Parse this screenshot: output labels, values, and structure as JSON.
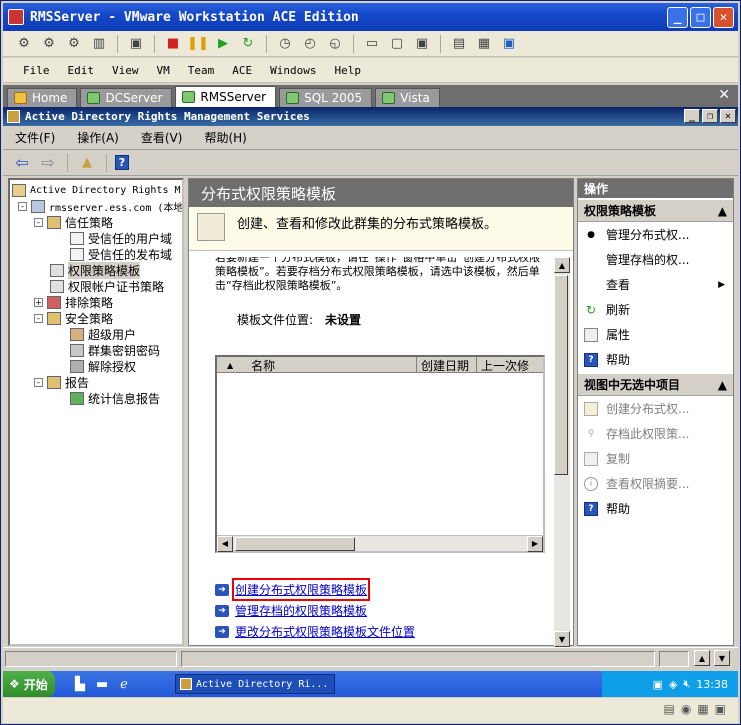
{
  "window": {
    "title": "RMSServer - VMware Workstation ACE Edition",
    "controls": [
      "_",
      "□",
      "✕"
    ]
  },
  "vmware_menu": [
    "File",
    "Edit",
    "View",
    "VM",
    "Team",
    "ACE",
    "Windows",
    "Help"
  ],
  "vm_tabs": [
    {
      "label": "Home",
      "icon": "home-icon",
      "active": false
    },
    {
      "label": "DCServer",
      "icon": "vm-icon",
      "active": false
    },
    {
      "label": "RMSServer",
      "icon": "vm-icon",
      "active": true
    },
    {
      "label": "SQL 2005",
      "icon": "vm-icon",
      "active": false
    },
    {
      "label": "Vista",
      "icon": "vm-icon",
      "active": false
    }
  ],
  "mmc": {
    "title": "Active Directory Rights Management Services",
    "menu": [
      "文件(F)",
      "操作(A)",
      "查看(V)",
      "帮助(H)"
    ]
  },
  "tree": {
    "root": "Active Directory Rights M",
    "server": "rmsserver.ess.com (本地)",
    "nodes": [
      {
        "label": "信任策略",
        "level": 2,
        "expander": "-"
      },
      {
        "label": "受信任的用户域",
        "level": 3,
        "expander": ""
      },
      {
        "label": "受信任的发布域",
        "level": 3,
        "expander": ""
      },
      {
        "label": "权限策略模板",
        "level": 2,
        "expander": "",
        "selected": true
      },
      {
        "label": "权限帐户证书策略",
        "level": 2,
        "expander": ""
      },
      {
        "label": "排除策略",
        "level": 2,
        "expander": "+"
      },
      {
        "label": "安全策略",
        "level": 2,
        "expander": "-"
      },
      {
        "label": "超级用户",
        "level": 3,
        "expander": ""
      },
      {
        "label": "群集密钥密码",
        "level": 3,
        "expander": ""
      },
      {
        "label": "解除授权",
        "level": 3,
        "expander": ""
      },
      {
        "label": "报告",
        "level": 2,
        "expander": "-"
      },
      {
        "label": "统计信息报告",
        "level": 3,
        "expander": ""
      }
    ]
  },
  "middle": {
    "header": "分布式权限策略模板",
    "banner": "创建、查看和修改此群集的分布式策略模板。",
    "intro": "若要新建一个分布式模板，请在“操作”窗格中单击“创建分布式权限策略模板”。若要存档分布式权限策略模板，请选中该模板，然后单击“存档此权限策略模板”。",
    "location_label": "模板文件位置:",
    "location_value": "未设置",
    "columns": [
      "名称",
      "创建日期",
      "上一次修"
    ],
    "links": [
      {
        "label": "创建分布式权限策略模板",
        "highlighted": true
      },
      {
        "label": "管理存档的权限策略模板",
        "highlighted": false
      },
      {
        "label": "更改分布式权限策略模板文件位置",
        "highlighted": false
      }
    ]
  },
  "actions": {
    "header": "操作",
    "section1": "权限策略模板",
    "section1_items": [
      {
        "label": "管理分布式权...",
        "icon": "bullet-icon",
        "enabled": true
      },
      {
        "label": "管理存档的权...",
        "icon": "",
        "enabled": true
      },
      {
        "label": "查看",
        "icon": "",
        "enabled": true,
        "submenu": true
      },
      {
        "label": "刷新",
        "icon": "refresh-icon",
        "enabled": true
      },
      {
        "label": "属性",
        "icon": "properties-icon",
        "enabled": true
      },
      {
        "label": "帮助",
        "icon": "help-icon",
        "enabled": true
      }
    ],
    "section2": "视图中无选中项目",
    "section2_items": [
      {
        "label": "创建分布式权...",
        "icon": "new-template-icon",
        "enabled": false
      },
      {
        "label": "存档此权限策...",
        "icon": "archive-icon",
        "enabled": false
      },
      {
        "label": "复制",
        "icon": "copy-icon",
        "enabled": false
      },
      {
        "label": "查看权限摘要...",
        "icon": "info-icon",
        "enabled": false
      },
      {
        "label": "帮助",
        "icon": "help-icon",
        "enabled": true
      }
    ]
  },
  "taskbar": {
    "start": "开始",
    "task": "Active Directory Ri...",
    "clock": "13:38"
  }
}
